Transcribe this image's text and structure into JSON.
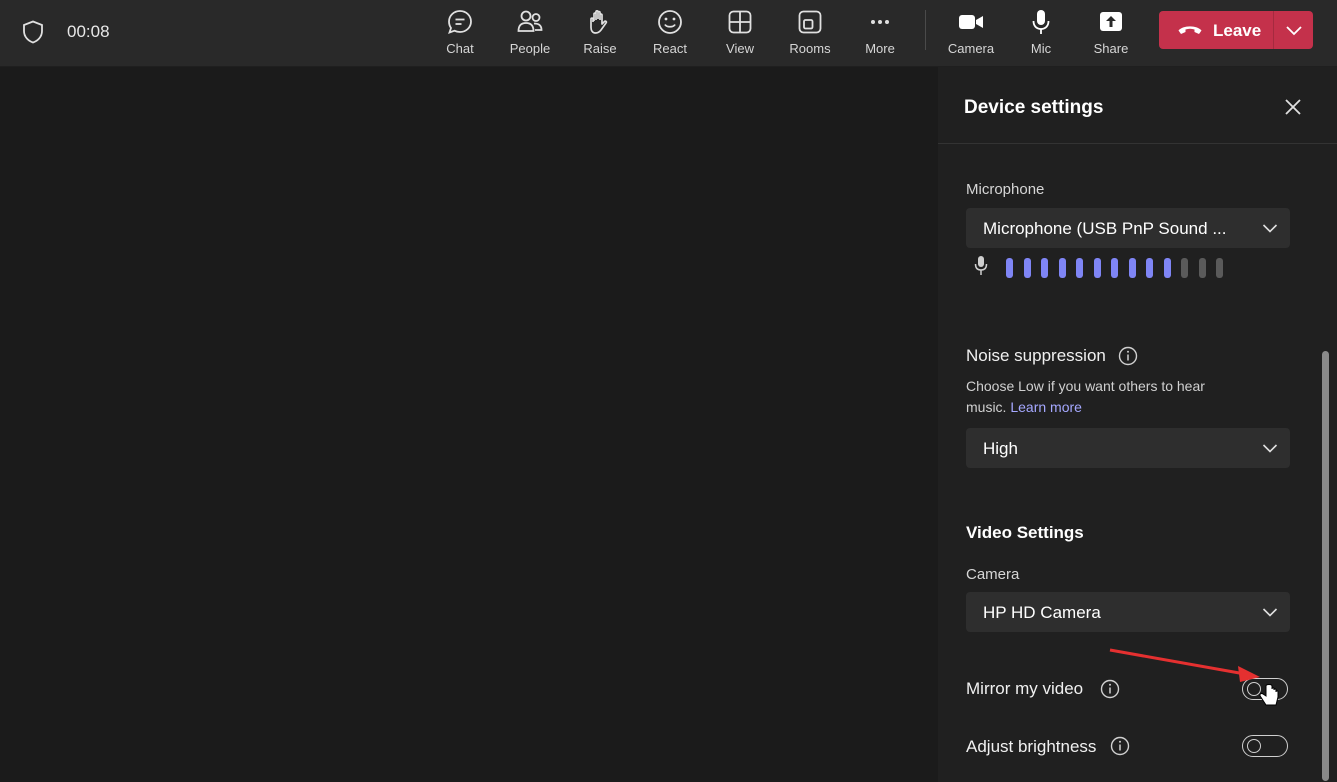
{
  "topbar": {
    "timer": "00:08",
    "tools": [
      {
        "label": "Chat",
        "icon": "chat-icon"
      },
      {
        "label": "People",
        "icon": "people-icon"
      },
      {
        "label": "Raise",
        "icon": "raise-hand-icon"
      },
      {
        "label": "React",
        "icon": "react-icon"
      },
      {
        "label": "View",
        "icon": "view-icon"
      },
      {
        "label": "Rooms",
        "icon": "rooms-icon"
      },
      {
        "label": "More",
        "icon": "more-icon"
      },
      {
        "label": "Camera",
        "icon": "camera-icon"
      },
      {
        "label": "Mic",
        "icon": "mic-icon"
      },
      {
        "label": "Share",
        "icon": "share-icon"
      }
    ],
    "leave_label": "Leave",
    "leave_color": "#c4314b"
  },
  "panel": {
    "title": "Device settings",
    "microphone": {
      "label": "Microphone",
      "selected": "Microphone (USB PnP Sound ...",
      "level_total": 13,
      "level_active": 10,
      "meter_color": "#7f85f5"
    },
    "noise": {
      "heading": "Noise suppression",
      "desc": "Choose Low if you want others to hear music.",
      "link": "Learn more",
      "selected": "High"
    },
    "video": {
      "heading": "Video Settings",
      "camera_label": "Camera",
      "camera_selected": "HP HD Camera",
      "mirror_label": "Mirror my video",
      "mirror_on": false,
      "brightness_label": "Adjust brightness",
      "brightness_on": false
    }
  },
  "accent_link_color": "#a5a8ff"
}
